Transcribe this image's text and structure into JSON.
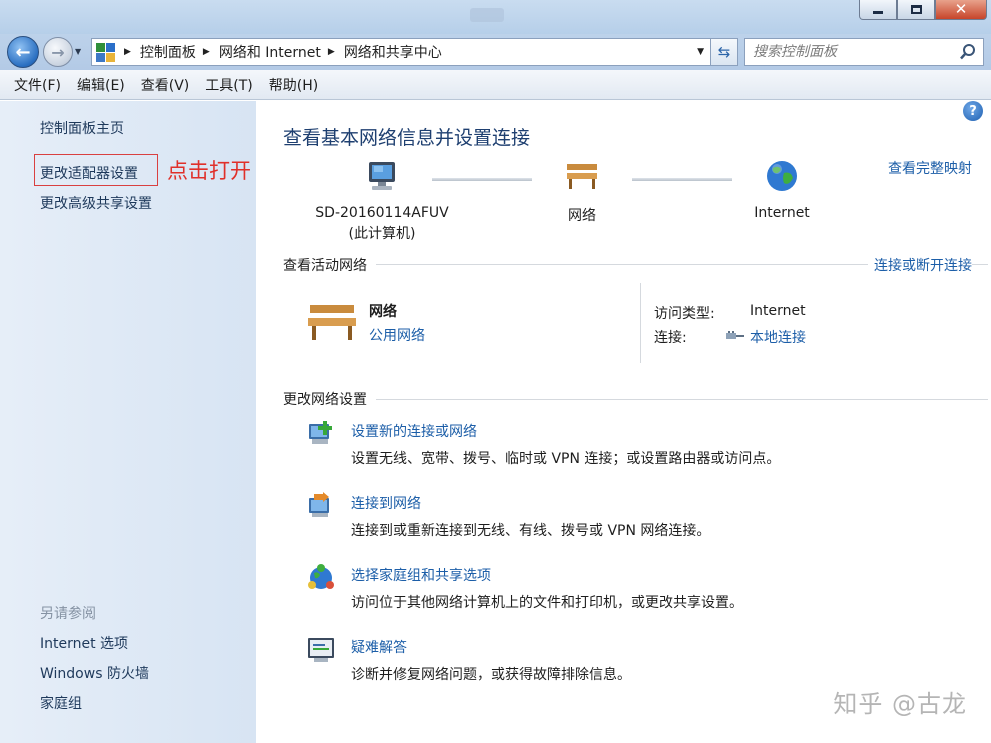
{
  "window": {
    "title_ghost": ""
  },
  "nav": {
    "breadcrumbs": [
      "控制面板",
      "网络和 Internet",
      "网络和共享中心"
    ],
    "search_placeholder": "搜索控制面板"
  },
  "menu": [
    "文件(F)",
    "编辑(E)",
    "查看(V)",
    "工具(T)",
    "帮助(H)"
  ],
  "sidebar": {
    "home": "控制面板主页",
    "change_adapter": "更改适配器设置",
    "change_advanced": "更改高级共享设置",
    "see_also_heading": "另请参阅",
    "see_also": [
      "Internet 选项",
      "Windows 防火墙",
      "家庭组"
    ]
  },
  "annotation": {
    "text": "点击打开",
    "color": "#e0302a"
  },
  "main": {
    "title": "查看基本网络信息并设置连接",
    "full_map_link": "查看完整映射",
    "nodes": [
      {
        "name": "SD-20160114AFUV",
        "sub": "(此计算机)",
        "icon": "computer-icon"
      },
      {
        "name": "网络",
        "sub": "",
        "icon": "bench-icon"
      },
      {
        "name": "Internet",
        "sub": "",
        "icon": "globe-icon"
      }
    ],
    "active_section": {
      "title": "查看活动网络",
      "link": "连接或断开连接",
      "network_name": "网络",
      "network_type": "公用网络",
      "access_type_label": "访问类型:",
      "access_type_value": "Internet",
      "connection_label": "连接:",
      "connection_value": "本地连接"
    },
    "settings_section": {
      "title": "更改网络设置",
      "tasks": [
        {
          "link": "设置新的连接或网络",
          "desc": "设置无线、宽带、拨号、临时或 VPN 连接；或设置路由器或访问点。",
          "icon": "new-connection-icon"
        },
        {
          "link": "连接到网络",
          "desc": "连接到或重新连接到无线、有线、拨号或 VPN 网络连接。",
          "icon": "connect-network-icon"
        },
        {
          "link": "选择家庭组和共享选项",
          "desc": "访问位于其他网络计算机上的文件和打印机，或更改共享设置。",
          "icon": "homegroup-icon"
        },
        {
          "link": "疑难解答",
          "desc": "诊断并修复网络问题，或获得故障排除信息。",
          "icon": "troubleshoot-icon"
        }
      ]
    }
  },
  "watermark": "知乎 @古龙",
  "colors": {
    "link": "#1c5ea8",
    "title": "#1e3f70",
    "sidebar_bg": "#dde8f5"
  }
}
